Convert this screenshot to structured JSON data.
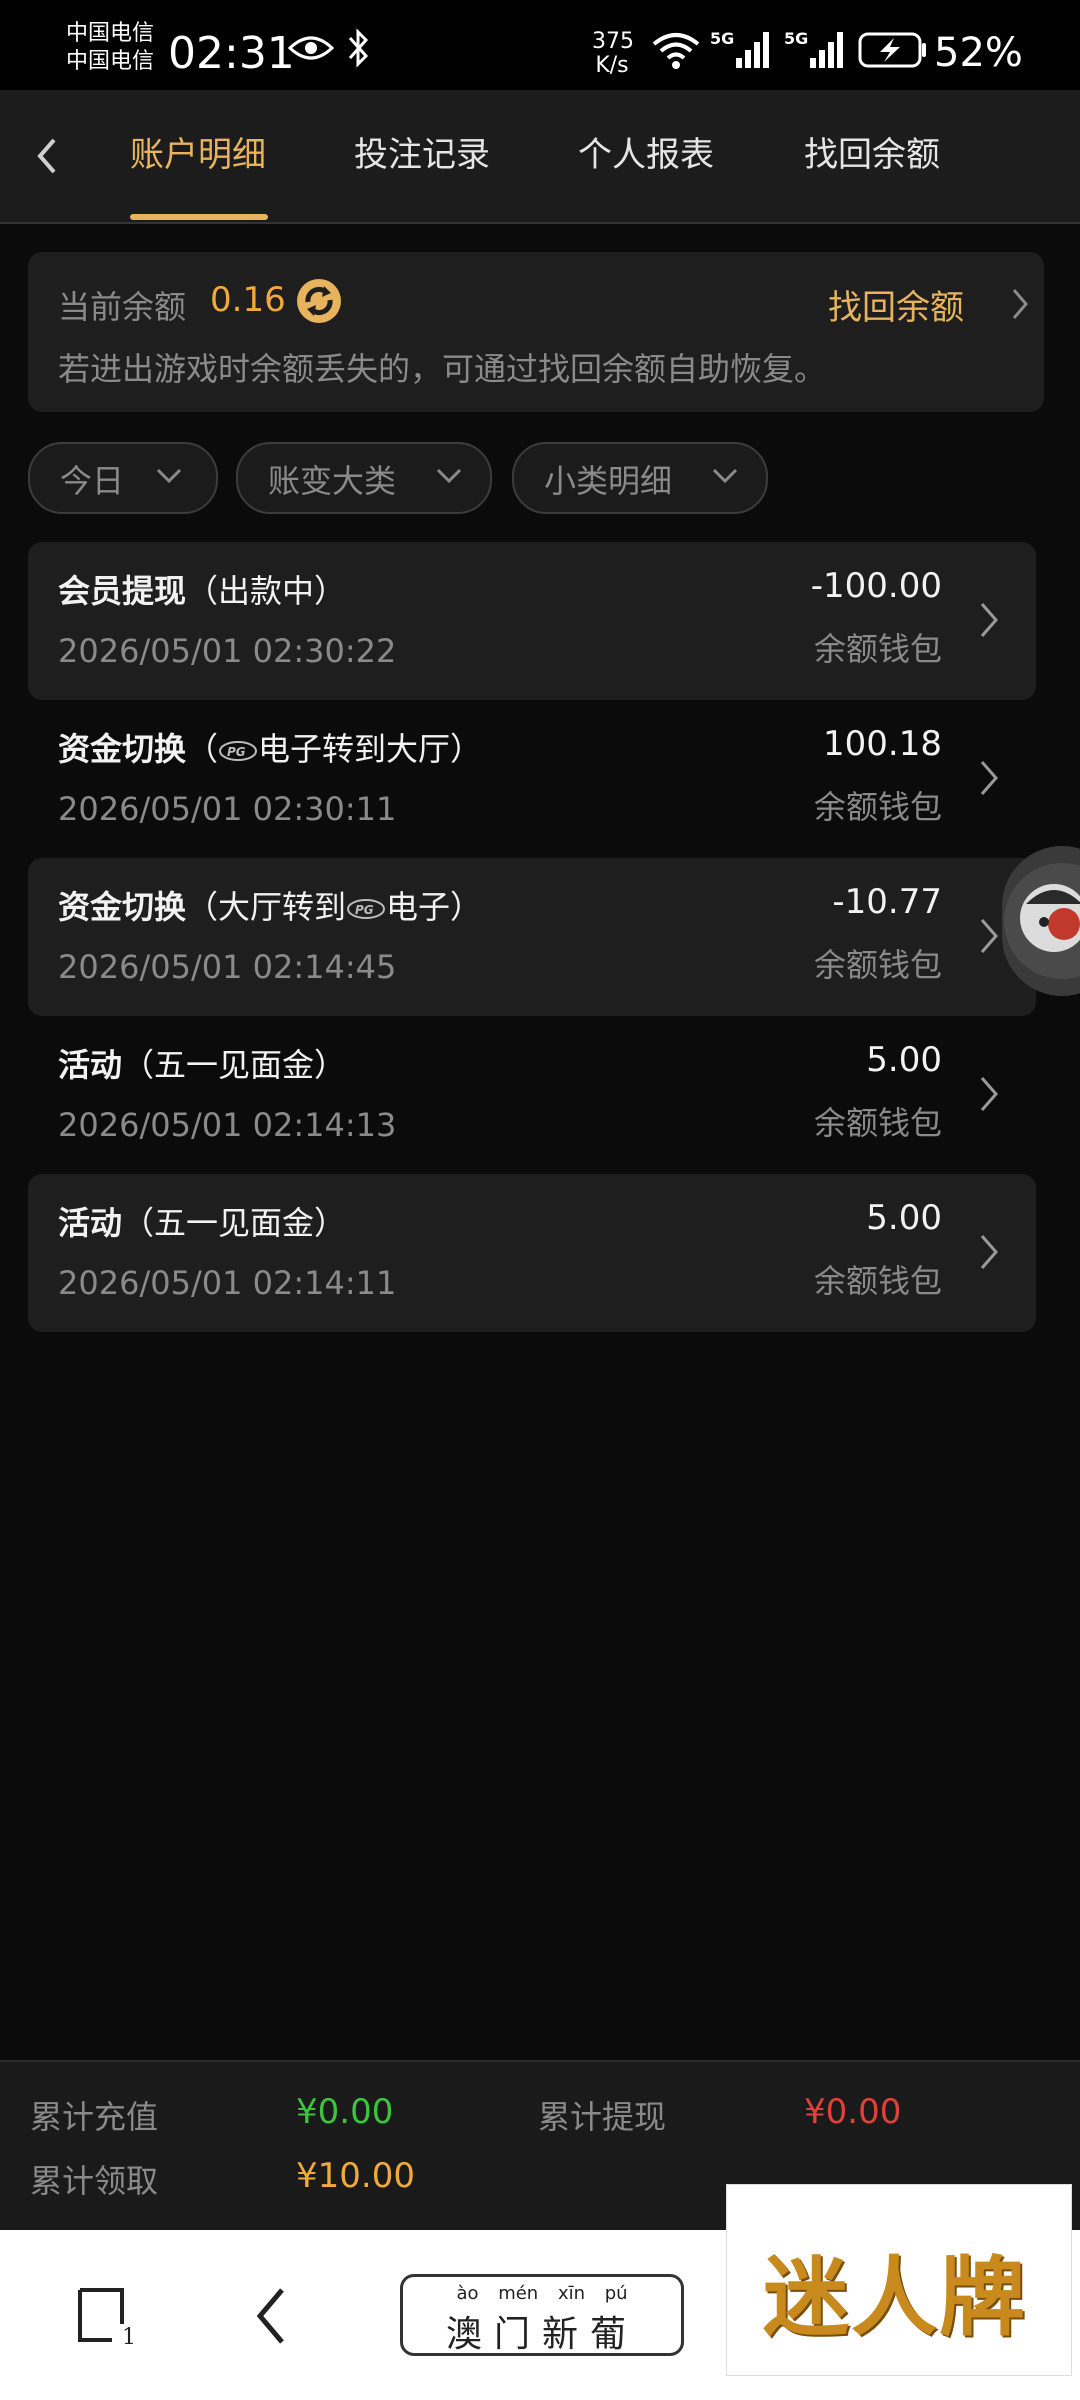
{
  "status_bar": {
    "carrier_1": "中国电信",
    "carrier_2": "中国电信",
    "time": "02:31",
    "net_speed_value": "375",
    "net_speed_unit": "K/s",
    "battery_percent": "52%"
  },
  "nav": {
    "tabs": [
      {
        "label": "账户明细",
        "active": true
      },
      {
        "label": "投注记录",
        "active": false
      },
      {
        "label": "个人报表",
        "active": false
      },
      {
        "label": "找回余额",
        "active": false
      }
    ],
    "accent_color": "#e7b45d"
  },
  "balance": {
    "label": "当前余额",
    "value": "0.16",
    "recover_label": "找回余额",
    "hint": "若进出游戏时余额丢失的，可通过找回余额自助恢复。"
  },
  "filters": [
    {
      "label": "今日"
    },
    {
      "label": "账变大类"
    },
    {
      "label": "小类明细"
    }
  ],
  "records": [
    {
      "title": "会员提现",
      "detail_pre": "（出款中）",
      "detail_post": "",
      "date": "2026/05/01 02:30:22",
      "amount": "-100.00",
      "wallet": "余额钱包"
    },
    {
      "title": "资金切换",
      "detail_pre": "（",
      "detail_post": "电子转到大厅）",
      "date": "2026/05/01 02:30:11",
      "amount": "100.18",
      "wallet": "余额钱包"
    },
    {
      "title": "资金切换",
      "detail_pre": "（大厅转到",
      "detail_post": "电子）",
      "date": "2026/05/01 02:14:45",
      "amount": "-10.77",
      "wallet": "余额钱包"
    },
    {
      "title": "活动",
      "detail_pre": "（五一见面金）",
      "detail_post": "",
      "date": "2026/05/01 02:14:13",
      "amount": "5.00",
      "wallet": "余额钱包"
    },
    {
      "title": "活动",
      "detail_pre": "（五一见面金）",
      "detail_post": "",
      "date": "2026/05/01 02:14:11",
      "amount": "5.00",
      "wallet": "余额钱包"
    }
  ],
  "summary": {
    "total_deposit_label": "累计充值",
    "total_deposit_value": "¥0.00",
    "total_withdraw_label": "累计提现",
    "total_withdraw_value": "¥0.00",
    "total_claimed_label": "累计领取",
    "total_claimed_value": "¥10.00",
    "colors": {
      "deposit": "#3cc43c",
      "withdraw": "#e0413a",
      "claimed": "#f2a93b"
    }
  },
  "bottom_bar": {
    "tab_count": "1",
    "brand_pinyin": "ào mén xīn pú",
    "brand_name": "澳门新葡"
  },
  "watermark": {
    "text": "迷人牌"
  }
}
